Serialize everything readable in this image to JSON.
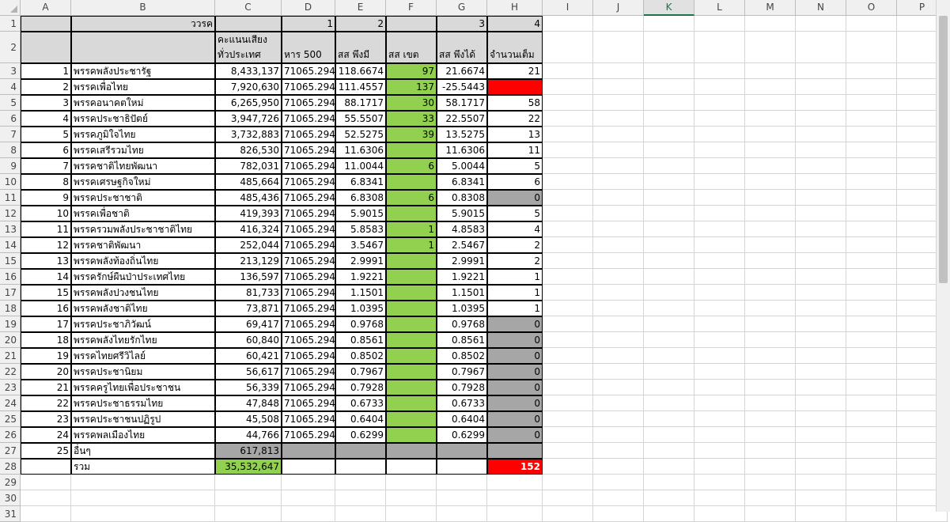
{
  "columns": [
    "A",
    "B",
    "C",
    "D",
    "E",
    "F",
    "G",
    "H",
    "I",
    "J",
    "K",
    "L",
    "M",
    "N",
    "O",
    "P"
  ],
  "selected_column": "K",
  "header_row1": {
    "B": "ววรค",
    "D": "1",
    "E": "2",
    "G": "3",
    "H": "4"
  },
  "header_row2": {
    "C": "คะแนนเสียง\nทั่วประเทศ",
    "D": "หาร 500",
    "E": "สส พึงมี",
    "F": "สส เขต",
    "G": "สส พึงได้",
    "H": "จำนวนเต็ม"
  },
  "rows": [
    {
      "no": "1",
      "name": "พรรคพลังประชารัฐ",
      "votes": "8,433,137",
      "div": "71065.294",
      "should": "118.6674",
      "district": "97",
      "get": "21.6674",
      "int": "21"
    },
    {
      "no": "2",
      "name": "พรรคเพื่อไทย",
      "votes": "7,920,630",
      "div": "71065.294",
      "should": "111.4557",
      "district": "137",
      "get": "-25.5443",
      "int": "",
      "int_style": "red"
    },
    {
      "no": "3",
      "name": "พรรคอนาคตใหม่",
      "votes": "6,265,950",
      "div": "71065.294",
      "should": "88.1717",
      "district": "30",
      "get": "58.1717",
      "int": "58"
    },
    {
      "no": "4",
      "name": "พรรคประชาธิปัตย์",
      "votes": "3,947,726",
      "div": "71065.294",
      "should": "55.5507",
      "district": "33",
      "get": "22.5507",
      "int": "22"
    },
    {
      "no": "5",
      "name": "พรรคภูมิใจไทย",
      "votes": "3,732,883",
      "div": "71065.294",
      "should": "52.5275",
      "district": "39",
      "get": "13.5275",
      "int": "13"
    },
    {
      "no": "6",
      "name": "พรรคเสรีรวมไทย",
      "votes": "826,530",
      "div": "71065.294",
      "should": "11.6306",
      "district": "",
      "get": "11.6306",
      "int": "11"
    },
    {
      "no": "7",
      "name": "พรรคชาติไทยพัฒนา",
      "votes": "782,031",
      "div": "71065.294",
      "should": "11.0044",
      "district": "6",
      "get": "5.0044",
      "int": "5"
    },
    {
      "no": "8",
      "name": "พรรคเศรษฐกิจใหม่",
      "votes": "485,664",
      "div": "71065.294",
      "should": "6.8341",
      "district": "",
      "get": "6.8341",
      "int": "6"
    },
    {
      "no": "9",
      "name": "พรรคประชาชาติ",
      "votes": "485,436",
      "div": "71065.294",
      "should": "6.8308",
      "district": "6",
      "get": "0.8308",
      "int": "0",
      "int_style": "dgray"
    },
    {
      "no": "10",
      "name": "พรรคเพื่อชาติ",
      "votes": "419,393",
      "div": "71065.294",
      "should": "5.9015",
      "district": "",
      "get": "5.9015",
      "int": "5"
    },
    {
      "no": "11",
      "name": "พรรครวมพลังประชาชาติไทย",
      "votes": "416,324",
      "div": "71065.294",
      "should": "5.8583",
      "district": "1",
      "get": "4.8583",
      "int": "4"
    },
    {
      "no": "12",
      "name": "พรรคชาติพัฒนา",
      "votes": "252,044",
      "div": "71065.294",
      "should": "3.5467",
      "district": "1",
      "get": "2.5467",
      "int": "2"
    },
    {
      "no": "13",
      "name": "พรรคพลังท้องถิ่นไทย",
      "votes": "213,129",
      "div": "71065.294",
      "should": "2.9991",
      "district": "",
      "get": "2.9991",
      "int": "2"
    },
    {
      "no": "14",
      "name": "พรรครักษ์ผืนป่าประเทศไทย",
      "votes": "136,597",
      "div": "71065.294",
      "should": "1.9221",
      "district": "",
      "get": "1.9221",
      "int": "1"
    },
    {
      "no": "15",
      "name": "พรรคพลังปวงชนไทย",
      "votes": "81,733",
      "div": "71065.294",
      "should": "1.1501",
      "district": "",
      "get": "1.1501",
      "int": "1"
    },
    {
      "no": "16",
      "name": "พรรคพลังชาติไทย",
      "votes": "73,871",
      "div": "71065.294",
      "should": "1.0395",
      "district": "",
      "get": "1.0395",
      "int": "1"
    },
    {
      "no": "17",
      "name": "พรรคประชาภิวัฒน์",
      "votes": "69,417",
      "div": "71065.294",
      "should": "0.9768",
      "district": "",
      "get": "0.9768",
      "int": "0",
      "int_style": "dgray"
    },
    {
      "no": "18",
      "name": "พรรคพลังไทยรักไทย",
      "votes": "60,840",
      "div": "71065.294",
      "should": "0.8561",
      "district": "",
      "get": "0.8561",
      "int": "0",
      "int_style": "dgray"
    },
    {
      "no": "19",
      "name": "พรรคไทยศรีวิไลย์",
      "votes": "60,421",
      "div": "71065.294",
      "should": "0.8502",
      "district": "",
      "get": "0.8502",
      "int": "0",
      "int_style": "dgray"
    },
    {
      "no": "20",
      "name": "พรรคประชานิยม",
      "votes": "56,617",
      "div": "71065.294",
      "should": "0.7967",
      "district": "",
      "get": "0.7967",
      "int": "0",
      "int_style": "dgray"
    },
    {
      "no": "21",
      "name": "พรรคครูไทยเพื่อประชาชน",
      "votes": "56,339",
      "div": "71065.294",
      "should": "0.7928",
      "district": "",
      "get": "0.7928",
      "int": "0",
      "int_style": "dgray"
    },
    {
      "no": "22",
      "name": "พรรคประชาธรรมไทย",
      "votes": "47,848",
      "div": "71065.294",
      "should": "0.6733",
      "district": "",
      "get": "0.6733",
      "int": "0",
      "int_style": "dgray"
    },
    {
      "no": "23",
      "name": "พรรคประชาชนปฏิรูป",
      "votes": "45,508",
      "div": "71065.294",
      "should": "0.6404",
      "district": "",
      "get": "0.6404",
      "int": "0",
      "int_style": "dgray"
    },
    {
      "no": "24",
      "name": "พรรคพลเมืองไทย",
      "votes": "44,766",
      "div": "71065.294",
      "should": "0.6299",
      "district": "",
      "get": "0.6299",
      "int": "0",
      "int_style": "dgray"
    }
  ],
  "row27": {
    "no": "25",
    "name": "อื่นๆ",
    "votes": "617,813"
  },
  "row28": {
    "name": "รวม",
    "votes": "35,532,647",
    "int": "152"
  },
  "row_numbers": [
    "1",
    "2",
    "3",
    "4",
    "5",
    "6",
    "7",
    "8",
    "9",
    "10",
    "11",
    "12",
    "13",
    "14",
    "15",
    "16",
    "17",
    "18",
    "19",
    "20",
    "21",
    "22",
    "23",
    "24",
    "25",
    "26",
    "27",
    "28",
    "29",
    "30",
    "31"
  ],
  "colors": {
    "green": "#92d050",
    "red": "#ff0000",
    "gray": "#d9d9d9",
    "dark_gray": "#a6a6a6",
    "excel_green": "#217346"
  }
}
